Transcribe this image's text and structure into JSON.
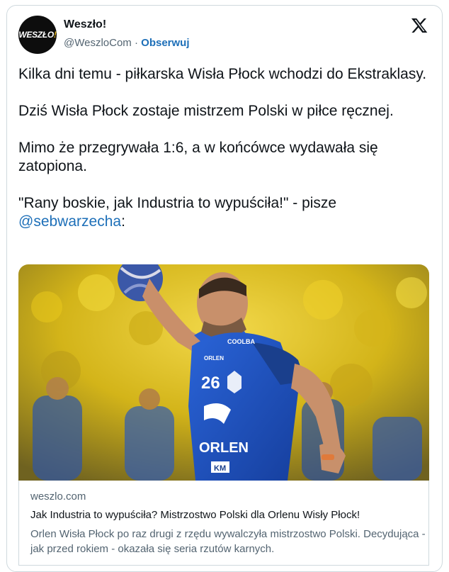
{
  "account": {
    "name": "Weszło!",
    "handle": "@WeszloCom",
    "separator": "·",
    "follow_label": "Obserwuj",
    "avatar_logo_text": "WESZŁO",
    "avatar_logo_excl": "!"
  },
  "tweet": {
    "line1": "Kilka dni temu - piłkarska Wisła Płock wchodzi do Ekstraklasy.",
    "line2": "Dziś Wisła Płock zostaje mistrzem Polski w piłce ręcznej.",
    "line3": "Mimo że przegrywała 1:6, a w końcówce wydawała się zatopiona.",
    "line4_prefix": "\"Rany boskie, jak Industria to wypuściła!\" - pisze",
    "mention": "@sebwarzecha",
    "line4_suffix": ":"
  },
  "media": {
    "jersey_number": "26",
    "jersey_sponsor": "ORLEN",
    "sleeve_text": "COOLBA",
    "chest_text": "ORLEN",
    "patch_text": "KM"
  },
  "link_card": {
    "domain": "weszlo.com",
    "title": "Jak Industria to wypuściła? Mistrzostwo Polski dla Orlenu Wisły Płock!",
    "description": "Orlen Wisła Płock po raz drugi z rzędu wywalczyła mistrzostwo Polski. Decydująca - jak przed rokiem - okazała się seria rzutów karnych."
  },
  "colors": {
    "link_blue": "#1d6fb8",
    "text": "#0f1419",
    "secondary_text": "#536471",
    "border": "#cfd9de",
    "jersey_blue": "#1f55c9",
    "crowd_yellow": "#e8c81c"
  },
  "icons": {
    "platform": "x-logo-icon"
  }
}
